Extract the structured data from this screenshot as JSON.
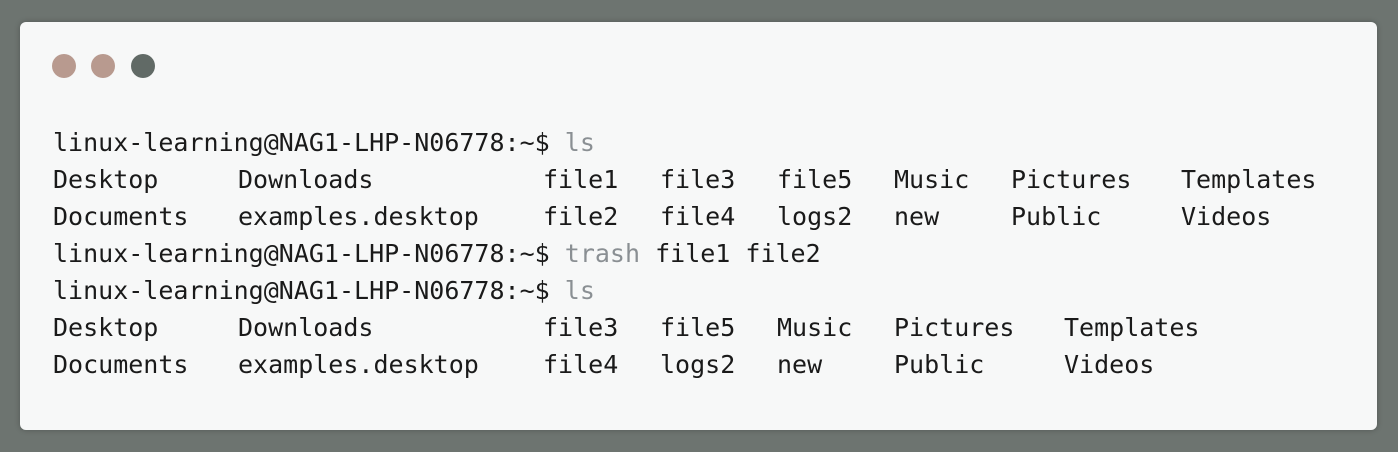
{
  "window": {
    "controls": [
      {
        "name": "close",
        "color": "#b89a8f"
      },
      {
        "name": "minimize",
        "color": "#b89a8f"
      },
      {
        "name": "zoom",
        "color": "#616a66"
      }
    ]
  },
  "terminal": {
    "prompt": "linux-learning@NAG1-LHP-N06778:~$",
    "commands": [
      {
        "cmd": "ls",
        "args": ""
      },
      {
        "cmd": "trash",
        "args": "file1 file2"
      },
      {
        "cmd": "ls",
        "args": ""
      }
    ],
    "listing1": {
      "row1": [
        "Desktop",
        "Downloads",
        "file1",
        "file3",
        "file5",
        "Music",
        "Pictures",
        "Templates"
      ],
      "row2": [
        "Documents",
        "examples.desktop",
        "file2",
        "file4",
        "logs2",
        "new",
        "Public",
        "Videos"
      ]
    },
    "listing2": {
      "row1": [
        "Desktop",
        "Downloads",
        "file3",
        "file5",
        "Music",
        "Pictures",
        "Templates"
      ],
      "row2": [
        "Documents",
        "examples.desktop",
        "file4",
        "logs2",
        "new",
        "Public",
        "Videos"
      ]
    }
  }
}
